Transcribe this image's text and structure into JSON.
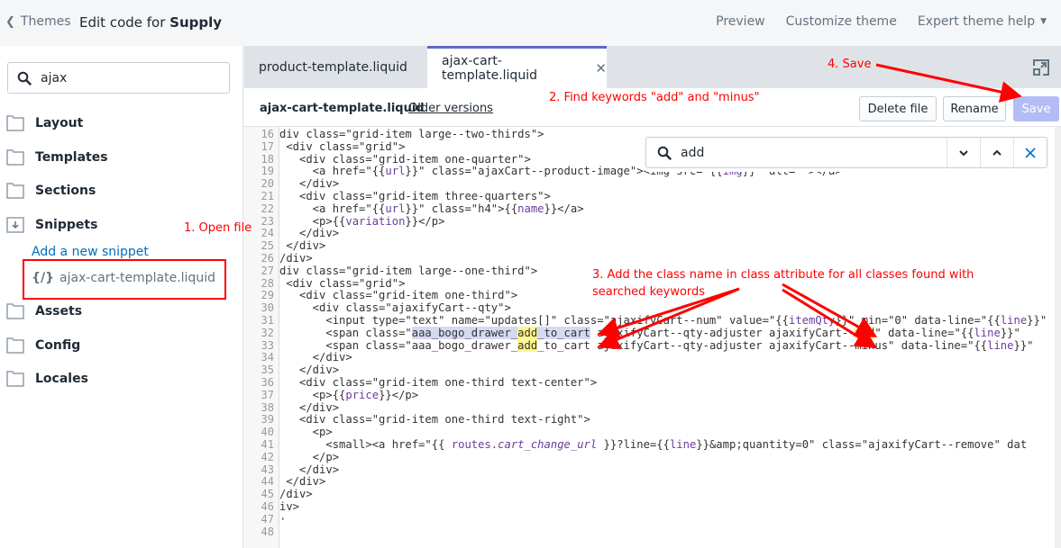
{
  "topbar": {
    "back_label": "Themes",
    "title_prefix": "Edit code for ",
    "title_theme": "Supply",
    "nav": [
      "Preview",
      "Customize theme",
      "Expert theme help"
    ]
  },
  "sidebar": {
    "search_value": "ajax",
    "folders": [
      {
        "label": "Layout",
        "icon": "folder-icon"
      },
      {
        "label": "Templates",
        "icon": "folder-icon"
      },
      {
        "label": "Sections",
        "icon": "folder-icon"
      },
      {
        "label": "Snippets",
        "icon": "folder-open-icon"
      },
      {
        "label": "Assets",
        "icon": "folder-icon"
      },
      {
        "label": "Config",
        "icon": "folder-icon"
      },
      {
        "label": "Locales",
        "icon": "folder-icon"
      }
    ],
    "add_snippet": "Add a new snippet",
    "snippet_icon": "{/}",
    "snippet_file": "ajax-cart-template.liquid"
  },
  "tabs": [
    {
      "label": "product-template.liquid",
      "active": false
    },
    {
      "label": "ajax-cart-template.liquid",
      "active": true,
      "close": "✕"
    }
  ],
  "file_header": {
    "filename": "ajax-cart-template.liquid",
    "older_versions": "Older versions",
    "delete": "Delete file",
    "rename": "Rename",
    "save": "Save"
  },
  "find": {
    "value": "add",
    "next": "⌄",
    "prev": "⌃",
    "close": "✕"
  },
  "colors": {
    "accent": "#5c6ac4",
    "save_disabled": "#b3bcf5",
    "annotation": "#ff0000",
    "link": "#006fbb",
    "match_highlight": "#fff68f",
    "selection": "#d6d9f2"
  },
  "annotations": {
    "step1": "1. Open file",
    "step2": "2. Find keywords \"add\" and \"minus\"",
    "step3_line1": "3. Add the class name in class attribute for all classes found with",
    "step3_line2": "searched keywords",
    "step4": "4. Save"
  },
  "code": {
    "line_numbers": [
      "16",
      "17",
      "18",
      "19",
      "20",
      "21",
      "22",
      "23",
      "24",
      "25",
      "26",
      "27",
      "28",
      "29",
      "30",
      "31",
      "32",
      "33",
      "34",
      "35",
      "36",
      "37",
      "38",
      "39",
      "40",
      "41",
      "42",
      "43",
      "44",
      "45",
      "46",
      "47",
      "48"
    ],
    "lines": [
      "div class=\"grid-item large--two-thirds\">",
      " <div class=\"grid\">",
      "   <div class=\"grid-item one-quarter\">",
      "     <a href=\"{{url}}\" class=\"ajaxCart--product-image\"><img src=\"{{img}}\" alt=\"\"></a>",
      "   </div>",
      "   <div class=\"grid-item three-quarters\">",
      "     <a href=\"{{url}}\" class=\"h4\">{{name}}</a>",
      "     <p>{{variation}}</p>",
      "   </div>",
      " </div>",
      "/div>",
      "div class=\"grid-item large--one-third\">",
      " <div class=\"grid\">",
      "   <div class=\"grid-item one-third\">",
      "     <div class=\"ajaxifyCart--qty\">",
      "       <input type=\"text\" name=\"updates[]\" class=\"ajaxifyCart--num\" value=\"{{itemQty}}\" min=\"0\" data-line=\"{{line}}\"",
      "       <span class=\"aaa_bogo_drawer_add_to_cart ajaxifyCart--qty-adjuster ajaxifyCart--add\" data-line=\"{{line}}\"",
      "       <span class=\"aaa_bogo_drawer_add_to_cart ajaxifyCart--qty-adjuster ajaxifyCart--minus\" data-line=\"{{line}}\"",
      "     </div>",
      "   </div>",
      "   <div class=\"grid-item one-third text-center\">",
      "     <p>{{price}}</p>",
      "   </div>",
      "   <div class=\"grid-item one-third text-right\">",
      "     <p>",
      "       <small><a href=\"{{ routes.cart_change_url }}?line={{line}}&amp;quantity=0\" class=\"ajaxifyCart--remove\" dat",
      "     </p>",
      "   </div>",
      " </div>",
      "/div>",
      "iv>",
      "·",
      ""
    ]
  }
}
